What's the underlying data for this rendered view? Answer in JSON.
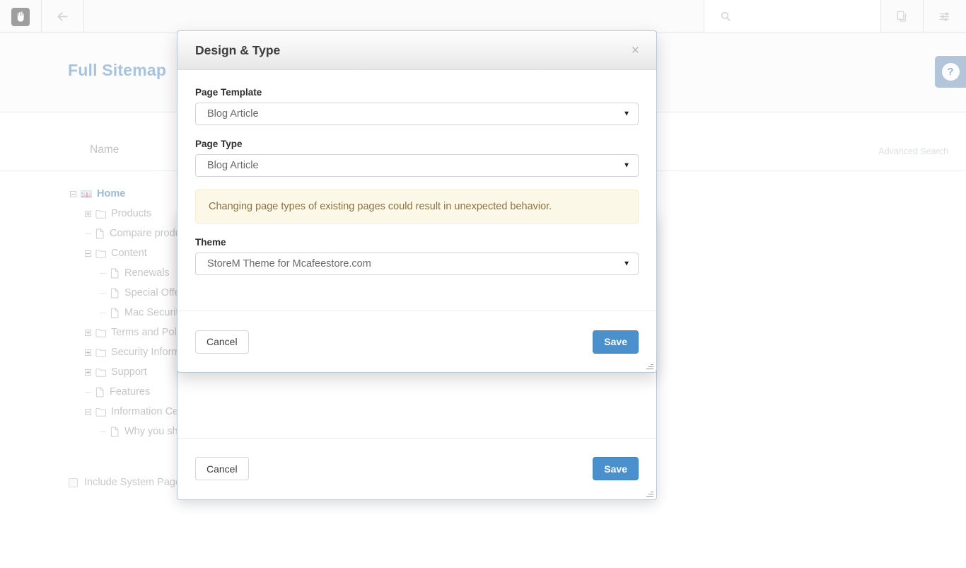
{
  "toolbar": {
    "logo_icon": "hand-palm-icon",
    "back_icon": "back-arrow-icon",
    "search_icon": "search-icon",
    "pages_icon": "copy-pages-icon",
    "settings_icon": "sliders-settings-icon"
  },
  "header": {
    "title": "Full Sitemap",
    "help_label": "?"
  },
  "search": {
    "icon": "search-icon",
    "placeholder": "Name",
    "value": "Name",
    "advanced_label": "Advanced Search"
  },
  "tree": {
    "items": [
      {
        "label": "Home",
        "indent": 0,
        "toggle": "minus",
        "icon": "uk-flag-icon",
        "kind": "home"
      },
      {
        "label": "Products",
        "indent": 1,
        "toggle": "plus",
        "icon": "folder-icon",
        "kind": "folder"
      },
      {
        "label": "Compare products",
        "indent": 1,
        "toggle": "none",
        "icon": "page-icon",
        "kind": "page"
      },
      {
        "label": "Content",
        "indent": 1,
        "toggle": "minus",
        "icon": "folder-icon",
        "kind": "folder"
      },
      {
        "label": "Renewals",
        "indent": 2,
        "toggle": "none",
        "icon": "page-icon",
        "kind": "page"
      },
      {
        "label": "Special Offers",
        "indent": 2,
        "toggle": "none",
        "icon": "page-icon",
        "kind": "page"
      },
      {
        "label": "Mac Security",
        "indent": 2,
        "toggle": "none",
        "icon": "page-icon",
        "kind": "page"
      },
      {
        "label": "Terms and Policies",
        "indent": 1,
        "toggle": "plus",
        "icon": "folder-icon",
        "kind": "folder"
      },
      {
        "label": "Security Information",
        "indent": 1,
        "toggle": "plus",
        "icon": "folder-icon",
        "kind": "folder"
      },
      {
        "label": "Support",
        "indent": 1,
        "toggle": "plus",
        "icon": "folder-icon",
        "kind": "folder"
      },
      {
        "label": "Features",
        "indent": 1,
        "toggle": "none",
        "icon": "page-icon",
        "kind": "page"
      },
      {
        "label": "Information Center",
        "indent": 1,
        "toggle": "minus",
        "icon": "folder-icon",
        "kind": "folder"
      },
      {
        "label": "Why you should monitor your childrens online access",
        "indent": 2,
        "toggle": "none",
        "icon": "page-icon",
        "kind": "page"
      }
    ]
  },
  "system_pages": {
    "label": "Include System Pages",
    "checked": false
  },
  "modal": {
    "title": "Design & Type",
    "close_label": "×",
    "page_template": {
      "label": "Page Template",
      "value": "Blog Article"
    },
    "page_type": {
      "label": "Page Type",
      "value": "Blog Article"
    },
    "warning": "Changing page types of existing pages could result in unexpected behavior.",
    "theme": {
      "label": "Theme",
      "value": "StoreM Theme for Mcafeestore.com"
    },
    "cancel_label": "Cancel",
    "save_label": "Save"
  },
  "modal_back": {
    "cancel_label": "Cancel",
    "save_label": "Save"
  },
  "colors": {
    "accent_blue": "#4a90cc",
    "title_blue": "#a8c3de",
    "warning_bg": "#fcf8e8",
    "warning_text": "#8c7140",
    "help_tab": "#b3c5d8"
  }
}
